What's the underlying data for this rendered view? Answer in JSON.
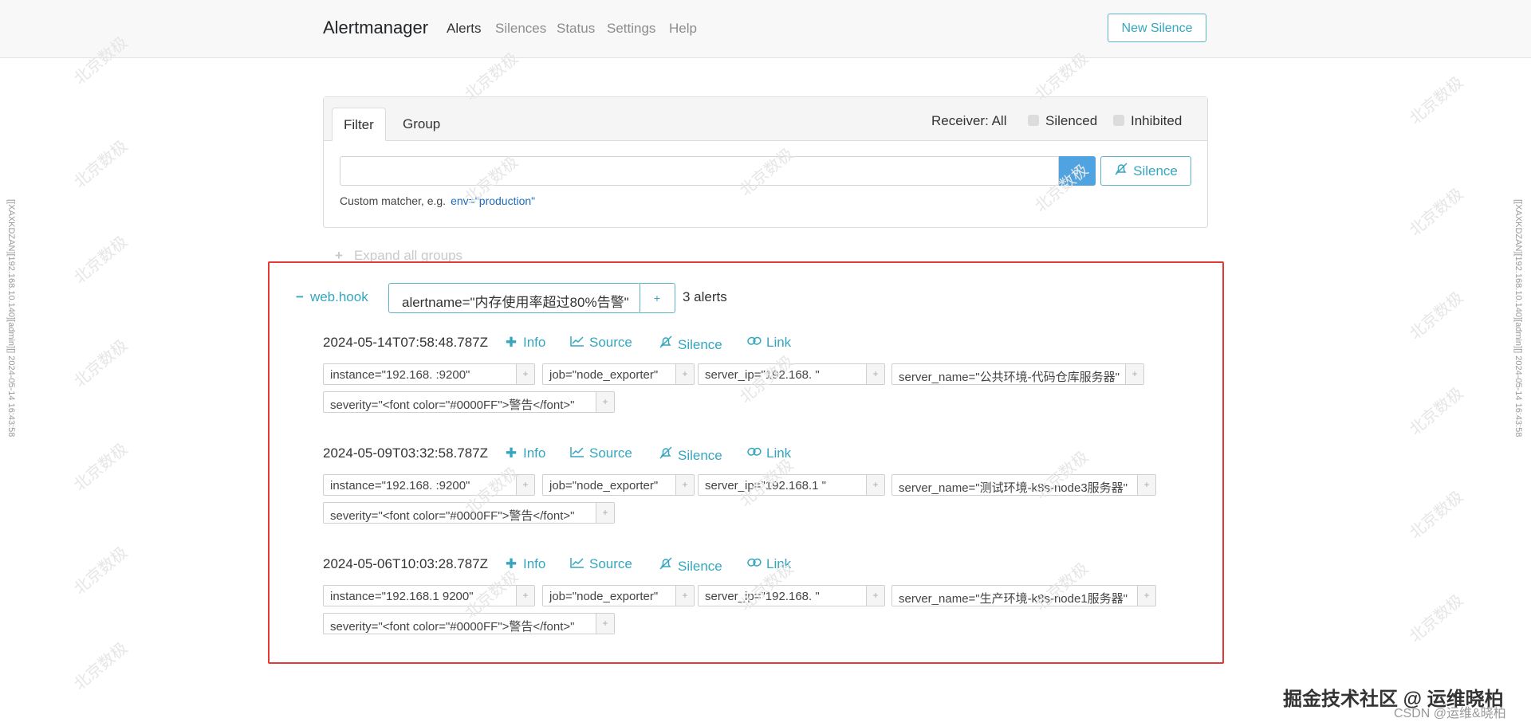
{
  "navbar": {
    "brand": "Alertmanager",
    "items": [
      {
        "label": "Alerts",
        "active": true
      },
      {
        "label": "Silences"
      },
      {
        "label": "Status"
      },
      {
        "label": "Settings"
      },
      {
        "label": "Help"
      }
    ],
    "new_silence_label": "New Silence"
  },
  "filter": {
    "tabs": [
      {
        "label": "Filter",
        "active": true
      },
      {
        "label": "Group"
      }
    ],
    "receiver_label": "Receiver: All",
    "silenced_label": "Silenced",
    "inhibited_label": "Inhibited",
    "input_value": "",
    "add_button": "+",
    "silence_button": "Silence",
    "hint_text": "Custom matcher, e.g.",
    "hint_example": "env=\"production\""
  },
  "expand_all": "Expand all groups",
  "group": {
    "receiver": "web.hook",
    "label": "alertname=\"内存使用率超过80%告警\"",
    "plus": "+",
    "count": "3 alerts"
  },
  "actions": {
    "info": "Info",
    "source": "Source",
    "silence": "Silence",
    "link": "Link"
  },
  "alerts": [
    {
      "timestamp": "2024-05-14T07:58:48.787Z",
      "labels": {
        "instance": "instance=\"192.168.        :9200\"",
        "job": "job=\"node_exporter\"",
        "server_ip": "server_ip=\"192.168.         \"",
        "server_name": "server_name=\"公共环境-代码仓库服务器\"",
        "severity": "severity=\"<font color=\"#0000FF\">警告</font>\""
      }
    },
    {
      "timestamp": "2024-05-09T03:32:58.787Z",
      "labels": {
        "instance": "instance=\"192.168.     :9200\"",
        "job": "job=\"node_exporter\"",
        "server_ip": "server_ip=\"192.168.1      \"",
        "server_name": "server_name=\"测试环境-k8s-node3服务器\"",
        "severity": "severity=\"<font color=\"#0000FF\">警告</font>\""
      }
    },
    {
      "timestamp": "2024-05-06T10:03:28.787Z",
      "labels": {
        "instance": "instance=\"192.168.1       9200\"",
        "job": "job=\"node_exporter\"",
        "server_ip": "server_ip=\"192.168.        \"",
        "server_name": "server_name=\"生产环境-k8s-node1服务器\"",
        "severity": "severity=\"<font color=\"#0000FF\">警告</font>\""
      }
    }
  ],
  "watermark": "北京数极",
  "side_text": "[[XAXKDZAN][192.168.10.140][admin][] 2024-05-14 16:43:58",
  "footer": {
    "line1": "掘金技术社区 @ 运维晓柏",
    "line2": "CSDN @运维&晓柏"
  }
}
